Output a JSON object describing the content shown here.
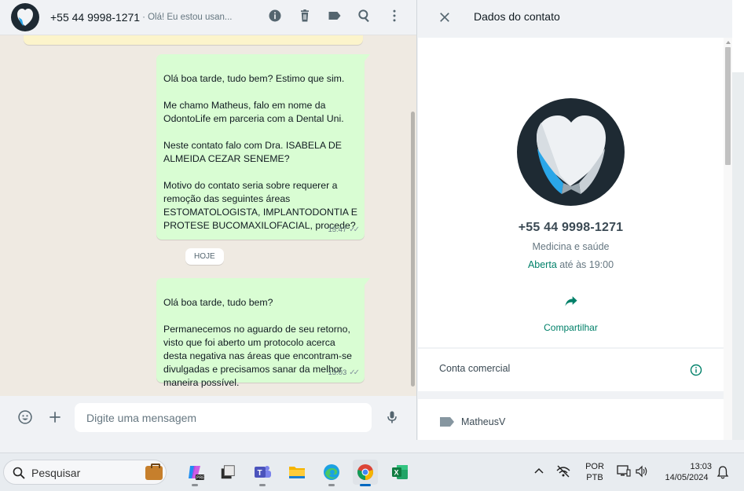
{
  "chat": {
    "header": {
      "title": "+55 44 9998-1271",
      "subtitle": "· Olá! Eu estou usan...",
      "icons": [
        "info-icon",
        "delete-icon",
        "label-icon",
        "search-icon",
        "menu-icon"
      ]
    },
    "messages": [
      {
        "text": "Olá boa tarde, tudo bem? Estimo que sim.\n\nMe chamo Matheus, falo em nome da OdontoLife em parceria com a Dental Uni.\n\nNeste contato falo com Dra. ISABELA DE ALMEIDA CEZAR SENEME?\n\nMotivo do contato seria sobre requerer a remoção das seguintes áreas ESTOMATOLOGISTA, IMPLANTODONTIA E PROTESE BUCOMAXILOFACIAL, procede?",
        "time": "15:47"
      },
      {
        "text": "Olá boa tarde, tudo bem?\n\nPermanecemos no aguardo de seu retorno, visto que foi aberto um protocolo acerca desta negativa nas áreas que encontram-se divulgadas e precisamos sanar da melhor maneira possível.",
        "time": "13:03"
      }
    ],
    "date_divider": "HOJE",
    "composer": {
      "placeholder": "Digite uma mensagem"
    }
  },
  "contact": {
    "title": "Dados do contato",
    "phone": "+55 44 9998-1271",
    "category": "Medicina e saúde",
    "status_open": "Aberta",
    "status_hours": " até às 19:00",
    "share_label": "Compartilhar",
    "business_label": "Conta comercial",
    "tag_label": "MatheusV",
    "colors": {
      "accent": "#008069",
      "bubble": "#d9fdd3"
    }
  },
  "taskbar": {
    "search_placeholder": "Pesquisar",
    "apps": [
      "copilot-icon",
      "app-icon",
      "teams-icon",
      "file-explorer-icon",
      "edge-icon",
      "chrome-icon",
      "excel-icon"
    ],
    "language": "POR",
    "layout": "PTB",
    "time": "13:03",
    "date": "14/05/2024"
  }
}
